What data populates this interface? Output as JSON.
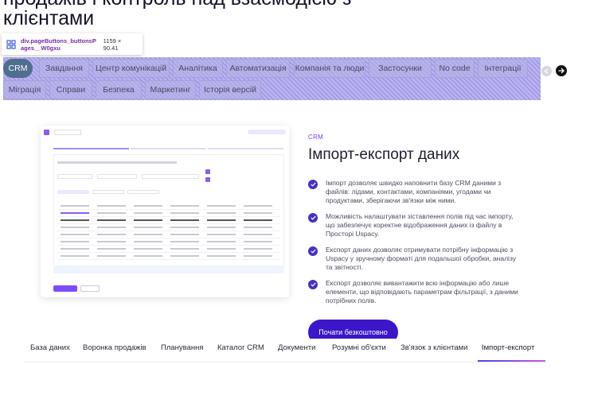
{
  "hero": {
    "title": "продажів і контроль над взаємодією з клієнтами"
  },
  "inspector_tooltip": {
    "selector": "div.pageButtons_buttonsPages__W0gxu",
    "size": "1159 × 90.41"
  },
  "page_buttons": {
    "row1": [
      "CRM",
      "Завдання",
      "Центр комунікацій",
      "Аналітика",
      "Автоматизація",
      "Компанія та люди",
      "Застосунки",
      "No code",
      "Інтеграції"
    ],
    "row2": [
      "Міграція",
      "Справи",
      "Безпека",
      "Маркетинг",
      "Історія версій"
    ],
    "active": "CRM"
  },
  "section": {
    "eyebrow": "CRM",
    "title": "Імпорт-експорт даних",
    "features": [
      "Імпорт дозволяє швидко наповнити базу CRM даними з файлів: лідами, контактами, компаніями, угодами чи продуктами, зберігаючи зв'язки між ними.",
      "Можливість налаштувати зіставлення полів під час імпорту, що забезпечує коректне відображення даних із файлу в Просторі Uspacy.",
      "Експорт даних дозволяє отримувати потрібну інформацію з Uspacy у зручному форматі для подальшої обробки, аналізу та звітності.",
      "Експорт дозволяє вивантажити всю інформацію або лише елементи, що відповідають параметрам фільтрації, з даними потрібних полів."
    ],
    "cta_label": "Почати безкоштовно"
  },
  "feature_tabs": {
    "items": [
      "База даних",
      "Воронка продажів",
      "Планування",
      "Каталог CRM",
      "Документи",
      "Розумні об'єкти",
      "Зв'язок з клієнтами",
      "Імпорт-експорт"
    ],
    "active": "Імпорт-експорт"
  },
  "colors": {
    "accent": "#3b17c9",
    "eyebrow": "#7d3ef1",
    "active_pill": "#4f6f8f",
    "inspector_overlay": "#b9b3ee"
  }
}
